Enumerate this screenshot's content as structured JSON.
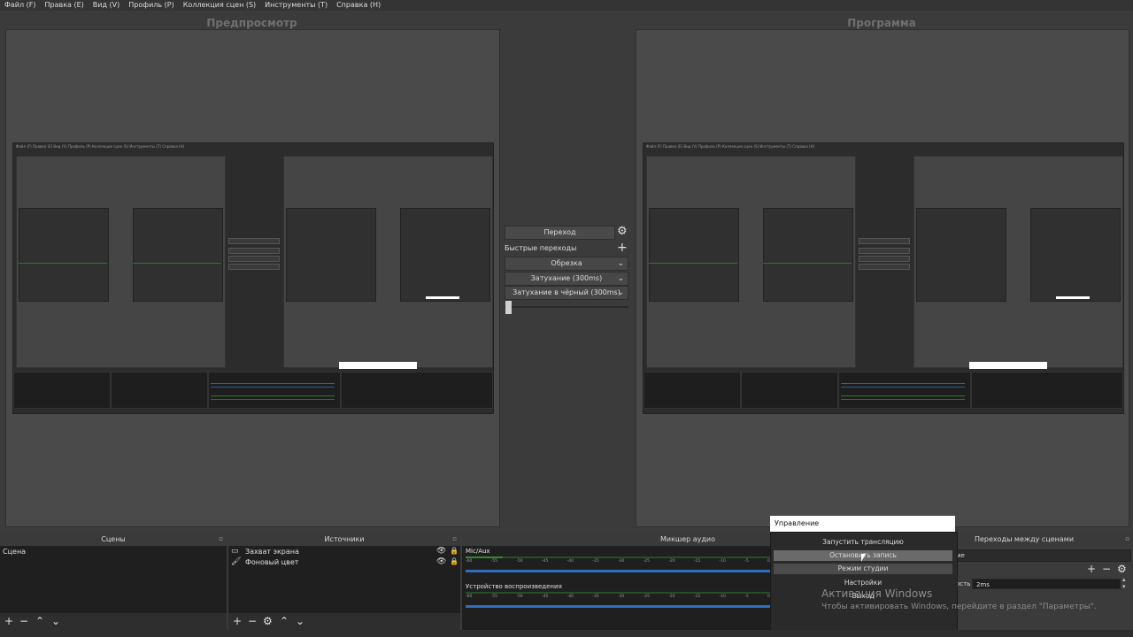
{
  "menu": [
    "Файл (F)",
    "Правка (E)",
    "Вид (V)",
    "Профиль (P)",
    "Коллекция сцен (S)",
    "Инструменты (T)",
    "Справка (H)"
  ],
  "preview_title": "Предпросмотр",
  "program_title": "Программа",
  "transition": {
    "button": "Переход",
    "quick_label": "Быстрые переходы",
    "items": [
      "Обрезка",
      "Затухание (300ms)",
      "Затухание в чёрный (300ms)"
    ]
  },
  "scenes": {
    "title": "Сцены",
    "items": [
      "Сцена"
    ]
  },
  "sources": {
    "title": "Источники",
    "items": [
      "Захват экрана",
      "Фоновый цвет"
    ]
  },
  "mixer": {
    "title": "Микшер аудио",
    "channels": [
      {
        "name": "Mic/Aux",
        "level": 0.12
      },
      {
        "name": "Устройство воспроизведения",
        "level": 0.0
      }
    ],
    "ticks": [
      "-60",
      "-55",
      "-50",
      "-45",
      "-40",
      "-35",
      "-30",
      "-25",
      "-20",
      "-15",
      "-10",
      "-5",
      "0"
    ]
  },
  "transitions_dock": {
    "title": "Переходы между сценами",
    "duration_label_fragment": "ость",
    "duration_value": "2ms",
    "select_fragment": "ие"
  },
  "controls_tooltip": "Управление",
  "context_menu": [
    "Запустить трансляцию",
    "Остановить запись",
    "Режим студии",
    "Настройки",
    "Выход"
  ],
  "activation": {
    "line1": "Активация Windows",
    "line2": "Чтобы активировать Windows, перейдите в раздел \"Параметры\"."
  },
  "colors": {
    "bg": "#3b3b3b",
    "dock": "#1f1f1f",
    "meter_green": "#2f8a2f",
    "meter_blue": "#2f6fc0"
  }
}
